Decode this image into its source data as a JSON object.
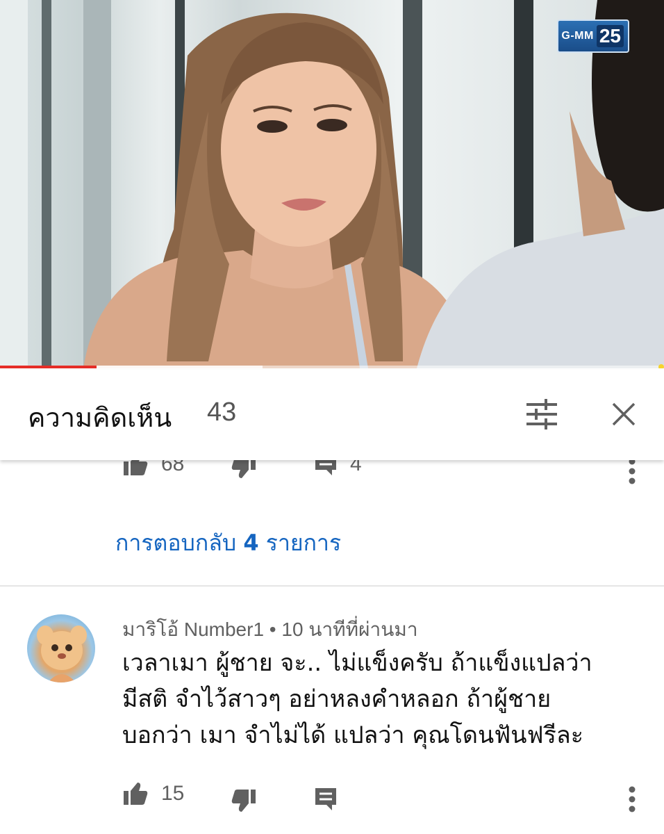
{
  "video": {
    "channel_logo_name": "G-MM",
    "channel_logo_number": "25",
    "progress_played": 0.145,
    "progress_buffered": 0.395,
    "colors": {
      "progress": "#e52d27",
      "buffer": "#ffffff"
    }
  },
  "comments_panel": {
    "title": "ความคิดเห็น",
    "count": "43",
    "sort_icon": "sort-icon",
    "close_icon": "close-icon"
  },
  "previous_comment": {
    "like_count": "68",
    "reply_count": "4",
    "replies_link_prefix": "การตอบกลับ",
    "replies_link_count": "4",
    "replies_link_suffix": "รายการ"
  },
  "comment": {
    "author": "มาริโอ้ Number1",
    "separator": "•",
    "time": "10 นาทีที่ผ่านมา",
    "text_lines": [
      "เวลาเมา  ผู้ชาย จะ.. ไม่แข็งครับ  ถ้าแข็งแปลว่า",
      "มีสติ  จำไว้สาวๆ  อย่าหลงคำหลอก ถ้าผู้ชาย",
      "บอกว่า เมา จำไม่ได้ แปลว่า คุณโดนฟันฟรีละ"
    ],
    "like_count": "15"
  },
  "colors": {
    "link": "#1565c0",
    "meta": "#606060",
    "icon": "#606060"
  }
}
